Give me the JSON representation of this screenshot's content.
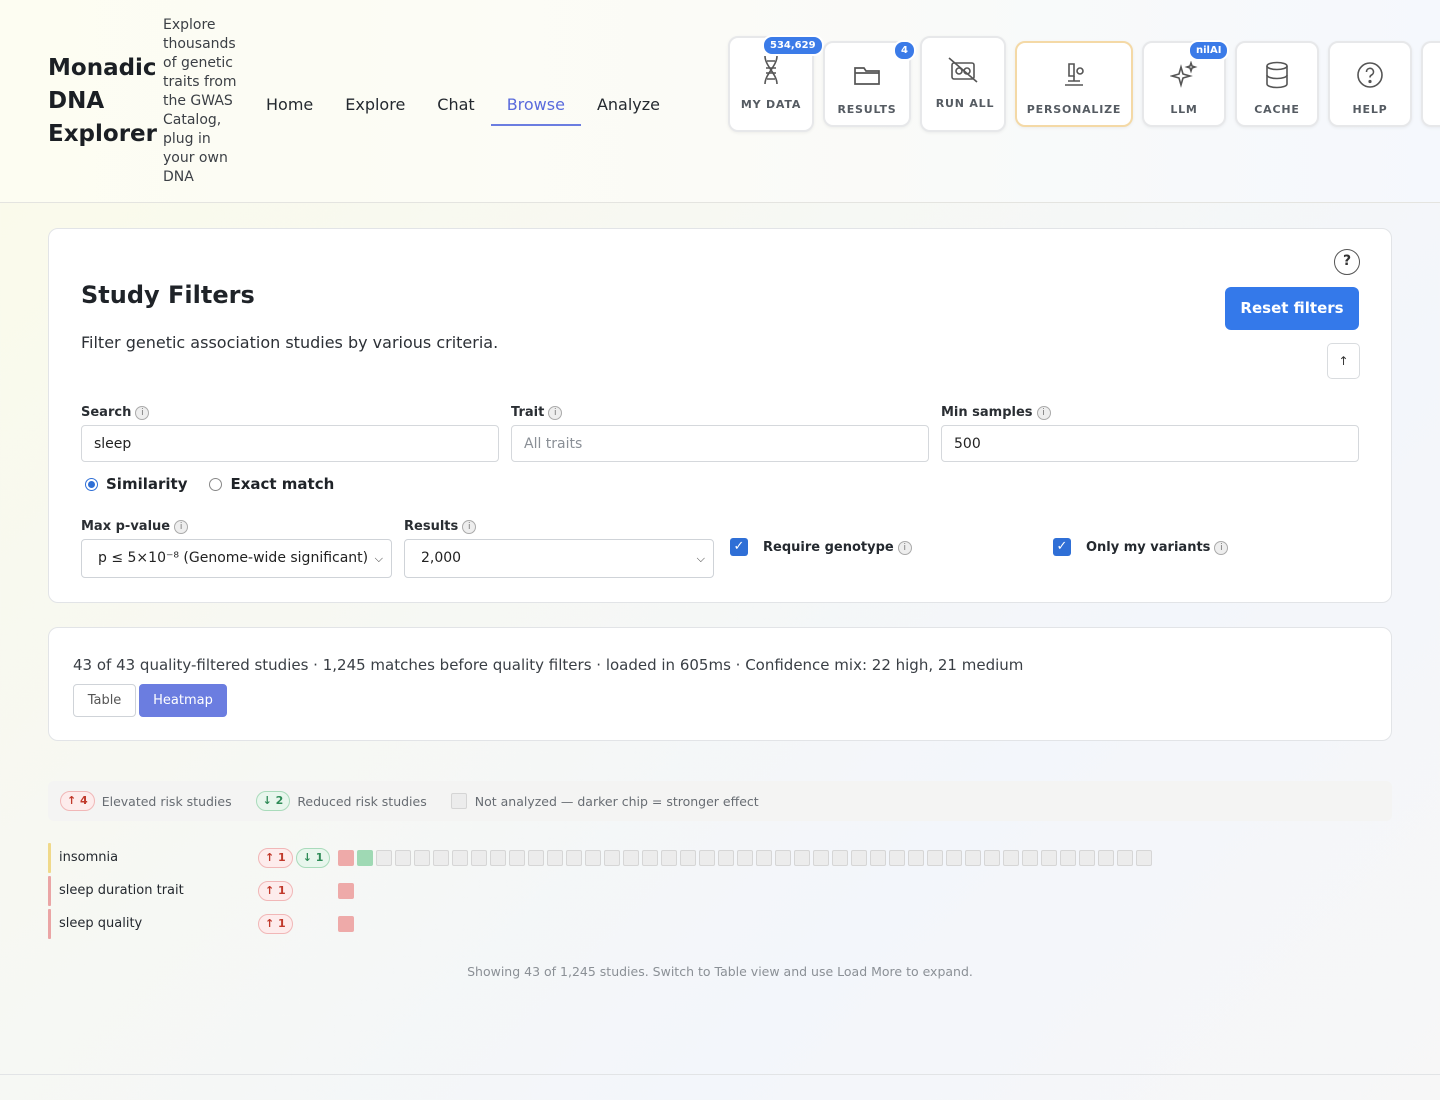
{
  "brand": {
    "title": "Monadic DNA Explorer",
    "tagline": "Explore thousands of genetic traits from the GWAS Catalog, plug in your own DNA"
  },
  "nav": {
    "items": [
      {
        "label": "Home"
      },
      {
        "label": "Explore"
      },
      {
        "label": "Chat"
      },
      {
        "label": "Browse",
        "active": true
      },
      {
        "label": "Analyze"
      }
    ]
  },
  "tools": {
    "my_data": {
      "label": "MY DATA",
      "badge": "534,629"
    },
    "results": {
      "label": "RESULTS",
      "badge": "4"
    },
    "run_all": {
      "label": "RUN ALL"
    },
    "personalize": {
      "label": "PERSONALIZE"
    },
    "llm": {
      "label": "LLM",
      "badge": "nilAI"
    },
    "cache": {
      "label": "CACHE"
    },
    "help": {
      "label": "HELP"
    }
  },
  "filters": {
    "help_glyph": "?",
    "title": "Study Filters",
    "description": "Filter genetic association studies by various criteria.",
    "reset_label": "Reset filters",
    "scroll_up_label": "↑",
    "search": {
      "label": "Search",
      "value": "sleep"
    },
    "trait": {
      "label": "Trait",
      "placeholder": "All traits"
    },
    "min_samples": {
      "label": "Min samples",
      "value": "500"
    },
    "match_mode": {
      "similarity": "Similarity",
      "exact": "Exact match",
      "selected": "similarity"
    },
    "max_pvalue": {
      "label": "Max p-value",
      "selected": "p ≤ 5×10⁻⁸ (Genome-wide significant)"
    },
    "results": {
      "label": "Results",
      "selected": "2,000"
    },
    "require_genotype": {
      "label": "Require genotype",
      "checked": true
    },
    "only_my_variants": {
      "label": "Only my variants",
      "checked": true
    }
  },
  "summary": {
    "text": "43 of 43 quality-filtered studies · 1,245 matches before quality filters · loaded in 605ms · Confidence mix: 22 high, 21 medium",
    "views": {
      "table": "Table",
      "heatmap": "Heatmap",
      "active": "heatmap"
    }
  },
  "legend": {
    "elevated_count": "↑ 4",
    "elevated_label": "Elevated risk studies",
    "reduced_count": "↓ 2",
    "reduced_label": "Reduced risk studies",
    "not_analyzed_label": "Not analyzed — darker chip = stronger effect"
  },
  "heatmap": {
    "rows": [
      {
        "name": "insomnia",
        "up": "↑ 1",
        "down": "↓ 1",
        "bar_color": "#f0d98a",
        "chips": [
          "r",
          "g",
          "n",
          "n",
          "n",
          "n",
          "n",
          "n",
          "n",
          "n",
          "n",
          "n",
          "n",
          "n",
          "n",
          "n",
          "n",
          "n",
          "n",
          "n",
          "n",
          "n",
          "n",
          "n",
          "n",
          "n",
          "n",
          "n",
          "n",
          "n",
          "n",
          "n",
          "n",
          "n",
          "n",
          "n",
          "n",
          "n",
          "n",
          "n",
          "n",
          "n",
          "n"
        ]
      },
      {
        "name": "sleep duration trait",
        "up": "↑ 1",
        "bar_color": "#eaa5a5",
        "chips": [
          "r"
        ]
      },
      {
        "name": "sleep quality",
        "up": "↑ 1",
        "bar_color": "#eaa5a5",
        "chips": [
          "r"
        ]
      }
    ]
  },
  "footnote": "Showing 43 of 1,245 studies. Switch to Table view and use Load More to expand."
}
